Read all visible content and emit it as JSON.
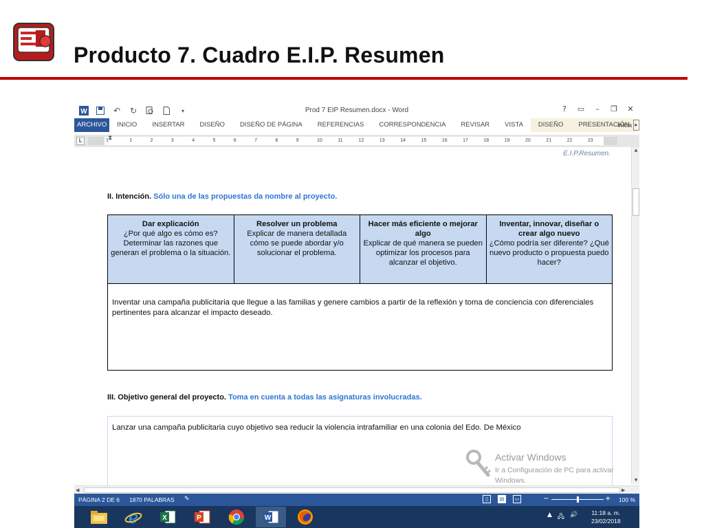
{
  "slide": {
    "title": "Producto 7. Cuadro E.I.P. Resumen",
    "accent_color": "#c00000",
    "logo_icon": "presentation-logo-icon"
  },
  "word": {
    "doc_title": "Prod 7 EIP Resumen.docx - Word",
    "title_bar_icons": [
      "word-icon",
      "save-icon",
      "undo-icon",
      "redo-icon",
      "print-preview-icon",
      "new-document-icon",
      "customize-qat-icon"
    ],
    "window_buttons": [
      "?",
      "▭",
      "–",
      "❐",
      "✕"
    ],
    "ribbon_tabs": [
      {
        "label": "ARCHIVO"
      },
      {
        "label": "INICIO"
      },
      {
        "label": "INSERTAR"
      },
      {
        "label": "DISEÑO"
      },
      {
        "label": "DISEÑO DE PÁGINA"
      },
      {
        "label": "REFERENCIAS"
      },
      {
        "label": "CORRESPONDENCIA"
      },
      {
        "label": "REVISAR"
      },
      {
        "label": "VISTA"
      },
      {
        "label": "DISEÑO"
      },
      {
        "label": "PRESENTACIÓN"
      }
    ],
    "ribbon_more_label": "Inicia",
    "ribbon_color": "#2b579a",
    "ruler_numbers": [
      "1",
      "1",
      "2",
      "3",
      "4",
      "5",
      "6",
      "7",
      "8",
      "9",
      "10",
      "11",
      "12",
      "13",
      "14",
      "15",
      "16",
      "17",
      "18",
      "19",
      "20",
      "21",
      "22",
      "23"
    ]
  },
  "document": {
    "header_text": "E.I.P.Resumen.",
    "section2_heading": "II. Intención.",
    "section2_instruction": "Sólo una de las propuestas da nombre al proyecto.",
    "table": {
      "columns": [
        {
          "title": "Dar explicación",
          "body": "¿Por qué algo es cómo es? Determinar las razones que generan el problema o la situación."
        },
        {
          "title": "Resolver un problema",
          "body": "Explicar de manera detallada cómo se puede abordar y/o solucionar el problema."
        },
        {
          "title": "Hacer más eficiente o mejorar algo",
          "body": "Explicar de qué manera se pueden optimizar los procesos para alcanzar el objetivo."
        },
        {
          "title": "Inventar, innovar,  diseñar o crear algo nuevo",
          "body": "¿Cómo podría ser diferente? ¿Qué nuevo producto o propuesta puedo hacer?"
        }
      ],
      "answer": "Inventar una campaña publicitaria que llegue a las familias y genere cambios a partir de la reflexión y toma de conciencia con diferenciales pertinentes para alcanzar el impacto deseado.",
      "header_fill": "#c6d9f1"
    },
    "section3_heading": "III. Objetivo general del proyecto.",
    "section3_instruction": "Toma en cuenta a todas las asignaturas  involucradas.",
    "objective_text": "Lanzar una campaña publicitaria cuyo objetivo sea reducir la violencia intrafamiliar en una colonia del Edo. De México"
  },
  "watermark": {
    "title": "Activar Windows",
    "subtitle": "Ir a Configuración de PC para activar Windows."
  },
  "status": {
    "page": "PÁGINA 2 DE 6",
    "words": "1870 PALABRAS",
    "zoom": "100 %",
    "zoom_fraction": 0.5
  },
  "taskbar": {
    "apps": [
      "file-explorer-icon",
      "internet-explorer-icon",
      "excel-icon",
      "powerpoint-icon",
      "chrome-icon",
      "word-icon",
      "firefox-icon"
    ],
    "active_app": "word-icon",
    "time": "11:18 a. m.",
    "date": "23/02/2018"
  }
}
